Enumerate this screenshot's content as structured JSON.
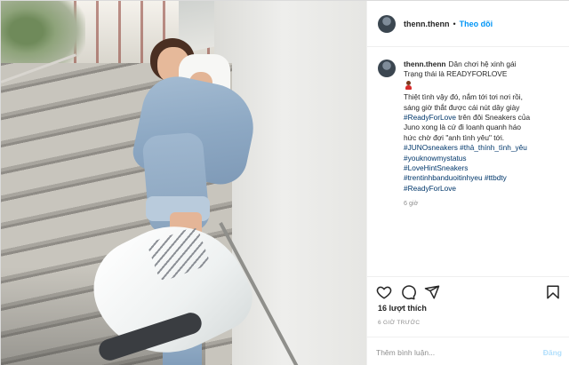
{
  "post": {
    "username": "thenn.thenn",
    "separator": "•",
    "follow_label": "Theo dõi",
    "caption": {
      "username": "thenn.thenn",
      "lines": [
        "Dân chơi hệ xinh gái",
        "Trạng thái là READYFORLOVE"
      ],
      "emoji": "dancer-emoji",
      "body_lines": [
        "Thiệt tình vậy đó, nắm tới tơi nơi rồi,",
        "sáng giờ thắt được cái nút dây giày",
        "#ReadyForLove trên đôi Sneakers của",
        "Juno xong là cứ đi loanh quanh háo",
        "hức chờ đợi \"anh tình yêu\" tới."
      ],
      "hashtag_lines": [
        "#JUNOsneakers #thả_thính_tình_yêu",
        "#youknowmystatus",
        "#LoveHintSneakers",
        "#trentinhbanduoitinhyeu #ttbdty",
        "#ReadyForLove"
      ],
      "time": "6 giờ"
    },
    "actions": {
      "like_icon": "heart-icon",
      "comment_icon": "comment-icon",
      "share_icon": "share-icon",
      "save_icon": "bookmark-icon"
    },
    "likes": "16 lượt thích",
    "posted_ago": "6 GIỜ TRƯỚC",
    "comment_placeholder": "Thêm bình luận...",
    "post_button": "Đăng"
  },
  "colors": {
    "link": "#0095f6",
    "hashtag": "#00376b",
    "muted": "#8e8e8e",
    "post_disabled": "#b2dffc"
  }
}
